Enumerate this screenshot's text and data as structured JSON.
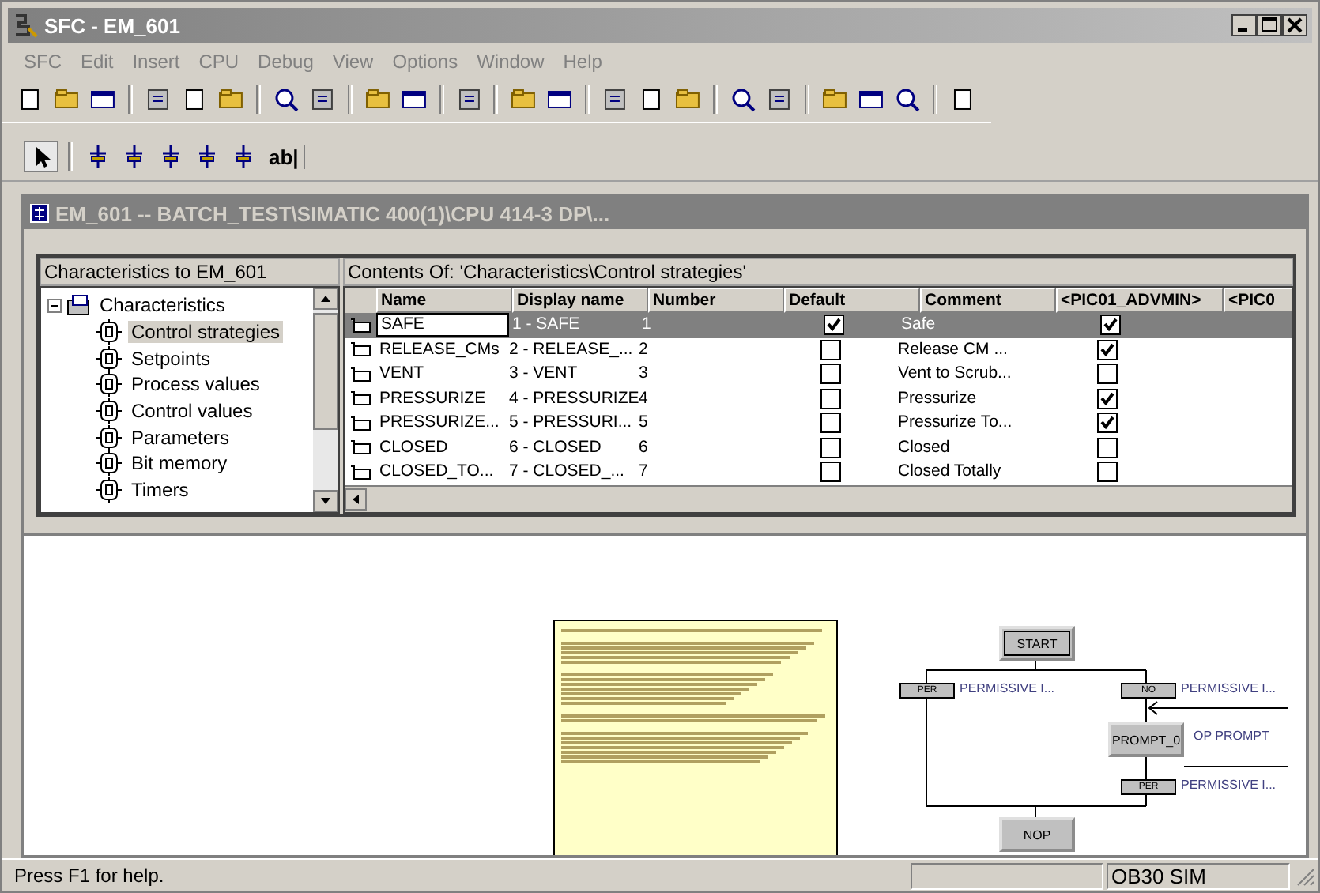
{
  "window": {
    "title": "SFC - EM_601"
  },
  "menu": [
    "SFC",
    "Edit",
    "Insert",
    "CPU",
    "Debug",
    "View",
    "Options",
    "Window",
    "Help"
  ],
  "toolbar2": {
    "text_tool": "ab|"
  },
  "child_window": {
    "title": "EM_601 -- BATCH_TEST\\SIMATIC 400(1)\\CPU 414-3 DP\\..."
  },
  "tree_pane": {
    "header": "Characteristics to EM_601",
    "tree": [
      {
        "label": "Characteristics",
        "expanded": true,
        "selected": false,
        "children": [
          {
            "label": "Control strategies",
            "selected": true
          },
          {
            "label": "Setpoints",
            "selected": false
          },
          {
            "label": "Process values",
            "selected": false
          },
          {
            "label": "Control values",
            "selected": false
          },
          {
            "label": "Parameters",
            "selected": false
          },
          {
            "label": "Bit memory",
            "selected": false
          },
          {
            "label": "Timers",
            "selected": false
          }
        ]
      }
    ]
  },
  "table_pane": {
    "header": "Contents Of: 'Characteristics\\Control strategies'",
    "columns": [
      "Name",
      "Display name",
      "Number",
      "Default",
      "Comment",
      "<PIC01_ADVMIN>",
      "<PIC0"
    ],
    "rows": [
      {
        "name": "SAFE",
        "display_name": "1 - SAFE",
        "number": "1",
        "default": true,
        "comment": "Safe",
        "pic01": true,
        "selected": true
      },
      {
        "name": "RELEASE_CMs",
        "display_name": "2 - RELEASE_...",
        "number": "2",
        "default": false,
        "comment": "Release CM ...",
        "pic01": true,
        "selected": false
      },
      {
        "name": "VENT",
        "display_name": "3 - VENT",
        "number": "3",
        "default": false,
        "comment": "Vent to Scrub...",
        "pic01": false,
        "selected": false
      },
      {
        "name": "PRESSURIZE",
        "display_name": "4 - PRESSURIZE",
        "number": "4",
        "default": false,
        "comment": "Pressurize",
        "pic01": true,
        "selected": false
      },
      {
        "name": "PRESSURIZE...",
        "display_name": "5 - PRESSURI...",
        "number": "5",
        "default": false,
        "comment": "Pressurize To...",
        "pic01": true,
        "selected": false
      },
      {
        "name": "CLOSED",
        "display_name": "6 - CLOSED",
        "number": "6",
        "default": false,
        "comment": "Closed",
        "pic01": false,
        "selected": false
      },
      {
        "name": "CLOSED_TO...",
        "display_name": "7 - CLOSED_...",
        "number": "7",
        "default": false,
        "comment": "Closed Totally",
        "pic01": false,
        "selected": false
      }
    ]
  },
  "diagram": {
    "steps": [
      {
        "label": "START",
        "kind": "initial"
      },
      {
        "label": "PROMPT_0",
        "kind": "step"
      },
      {
        "label": "NOP",
        "kind": "step"
      }
    ],
    "transitions": [
      {
        "label": "PER"
      },
      {
        "label": "NO"
      },
      {
        "label": "PER"
      }
    ],
    "captions": [
      "PERMISSIVE I...",
      "PERMISSIVE I...",
      "OP PROMPT",
      "PERMISSIVE I..."
    ]
  },
  "status_bar": {
    "help": "Press F1 for help.",
    "mode": "OB30  SIM"
  }
}
